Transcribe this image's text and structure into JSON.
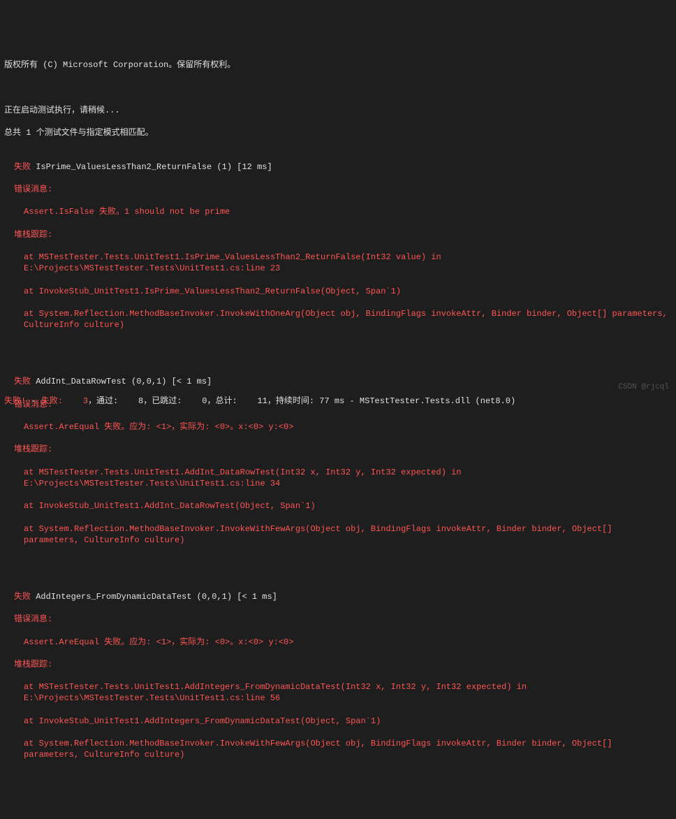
{
  "header": {
    "copyright": "版权所有 (C) Microsoft Corporation。保留所有权利。",
    "starting": "正在启动测试执行，请稍候...",
    "filesMatched": "总共 1 个测试文件与指定模式相匹配。"
  },
  "failLabel": "失败",
  "errorMessageLabel": "错误消息:",
  "stackTraceLabel": "堆栈跟踪:",
  "tests": [
    {
      "title": "IsPrime_ValuesLessThan2_ReturnFalse (1) [12 ms]",
      "errorMessage": "Assert.IsFalse 失败。1 should not be prime",
      "stack1": "at MSTestTester.Tests.UnitTest1.IsPrime_ValuesLessThan2_ReturnFalse(Int32 value) in E:\\Projects\\MSTestTester.Tests\\UnitTest1.cs:line 23",
      "stack2": "at InvokeStub_UnitTest1.IsPrime_ValuesLessThan2_ReturnFalse(Object, Span`1)",
      "stack3": "at System.Reflection.MethodBaseInvoker.InvokeWithOneArg(Object obj, BindingFlags invokeAttr, Binder binder, Object[] parameters, CultureInfo culture)"
    },
    {
      "title": "AddInt_DataRowTest (0,0,1) [< 1 ms]",
      "errorMessage": "Assert.AreEqual 失败。应为: <1>，实际为: <0>。x:<0> y:<0>",
      "stack1": "at MSTestTester.Tests.UnitTest1.AddInt_DataRowTest(Int32 x, Int32 y, Int32 expected) in E:\\Projects\\MSTestTester.Tests\\UnitTest1.cs:line 34",
      "stack2": "at InvokeStub_UnitTest1.AddInt_DataRowTest(Object, Span`1)",
      "stack3": "at System.Reflection.MethodBaseInvoker.InvokeWithFewArgs(Object obj, BindingFlags invokeAttr, Binder binder, Object[] parameters, CultureInfo culture)"
    },
    {
      "title": "AddIntegers_FromDynamicDataTest (0,0,1) [< 1 ms]",
      "errorMessage": "Assert.AreEqual 失败。应为: <1>，实际为: <0>。x:<0> y:<0>",
      "stack1": "at MSTestTester.Tests.UnitTest1.AddIntegers_FromDynamicDataTest(Int32 x, Int32 y, Int32 expected) in E:\\Projects\\MSTestTester.Tests\\UnitTest1.cs:line 56",
      "stack2": "at InvokeStub_UnitTest1.AddIntegers_FromDynamicDataTest(Object, Span`1)",
      "stack3": "at System.Reflection.MethodBaseInvoker.InvokeWithFewArgs(Object obj, BindingFlags invokeAttr, Binder binder, Object[] parameters, CultureInfo culture)"
    }
  ],
  "summary": {
    "failExcl": "失败!",
    "dash": " - ",
    "failedLabel": "失败:",
    "failedCount": "    3",
    "passedLabel": "，通过:",
    "passedCount": "    8",
    "skippedLabel": "，已跳过:",
    "skippedCount": "    0",
    "totalLabel": "，总计:",
    "totalCount": "    11",
    "durationLabel": "，持续时间: 77 ms",
    "tail": " - MSTestTester.Tests.dll (net8.0)"
  },
  "watermark": "CSDN @rjcql"
}
